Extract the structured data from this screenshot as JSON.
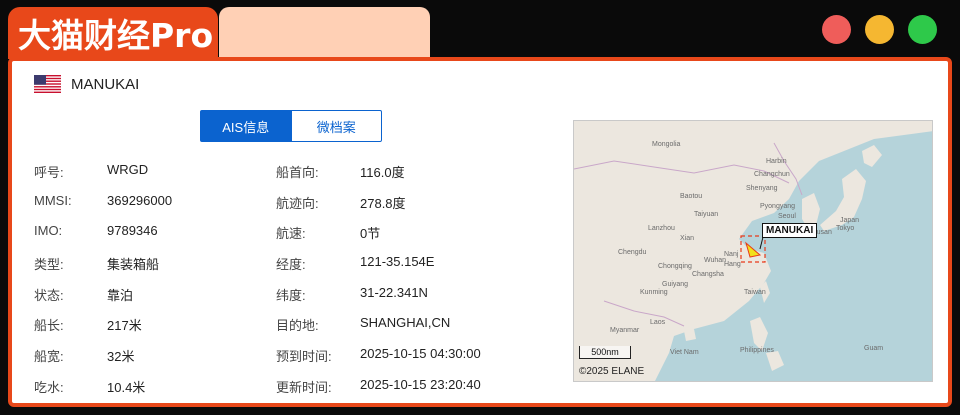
{
  "app": {
    "title": "大猫财经Pro"
  },
  "vessel": {
    "name": "MANUKAI",
    "flag_icon": "us-flag-icon"
  },
  "tabs": [
    {
      "label": "AIS信息",
      "active": true
    },
    {
      "label": "微档案",
      "active": false
    }
  ],
  "fields_left": [
    {
      "label": "呼号:",
      "value": "WRGD"
    },
    {
      "label": "MMSI:",
      "value": "369296000"
    },
    {
      "label": "IMO:",
      "value": "9789346"
    },
    {
      "label": "类型:",
      "value": "集装箱船"
    },
    {
      "label": "状态:",
      "value": "靠泊"
    },
    {
      "label": "船长:",
      "value": "217米"
    },
    {
      "label": "船宽:",
      "value": "32米"
    },
    {
      "label": "吃水:",
      "value": "10.4米"
    }
  ],
  "fields_right": [
    {
      "label": "船首向:",
      "value": "116.0度"
    },
    {
      "label": "航迹向:",
      "value": "278.8度"
    },
    {
      "label": "航速:",
      "value": "0节"
    },
    {
      "label": "经度:",
      "value": "121-35.154E"
    },
    {
      "label": "纬度:",
      "value": "31-22.341N"
    },
    {
      "label": "目的地:",
      "value": "SHANGHAI,CN"
    },
    {
      "label": "预到时间:",
      "value": "2025-10-15 04:30:00"
    },
    {
      "label": "更新时间:",
      "value": "2025-10-15 23:20:40"
    }
  ],
  "map": {
    "marker_label": "MANUKAI",
    "scale": "500nm",
    "copyright": "©2025 ELANE",
    "places": {
      "harbin": "Harbin",
      "changchun": "Changchun",
      "shenyang": "Shenyang",
      "pyongyang": "Pyongyang",
      "seoul": "Seoul",
      "busan": "Busan",
      "tokyo": "Tokyo",
      "japan": "Japan",
      "baotou": "Baotou",
      "taiyuan": "Taiyuan",
      "lanzhou": "Lanzhou",
      "xian": "Xian",
      "nanjing": "Nanj",
      "wuhan": "Wuhan",
      "hangzhou": "Hang",
      "chengdu": "Chengdu",
      "chongqing": "Chongqing",
      "changsha": "Changsha",
      "kunming": "Kunming",
      "guiyang": "Guiyang",
      "taiwan": "Taiwan",
      "myanmar": "Myanmar",
      "laos": "Laos",
      "vietnam": "Viet Nam",
      "philippines": "Philippines",
      "guam": "Guam",
      "mongolia": "Mongolia"
    }
  },
  "colors": {
    "brand_orange": "#e8481a",
    "accent_blue": "#0b63cf",
    "peach": "#ffd0b5",
    "sea": "#b5d3da",
    "land": "#ece7df"
  }
}
